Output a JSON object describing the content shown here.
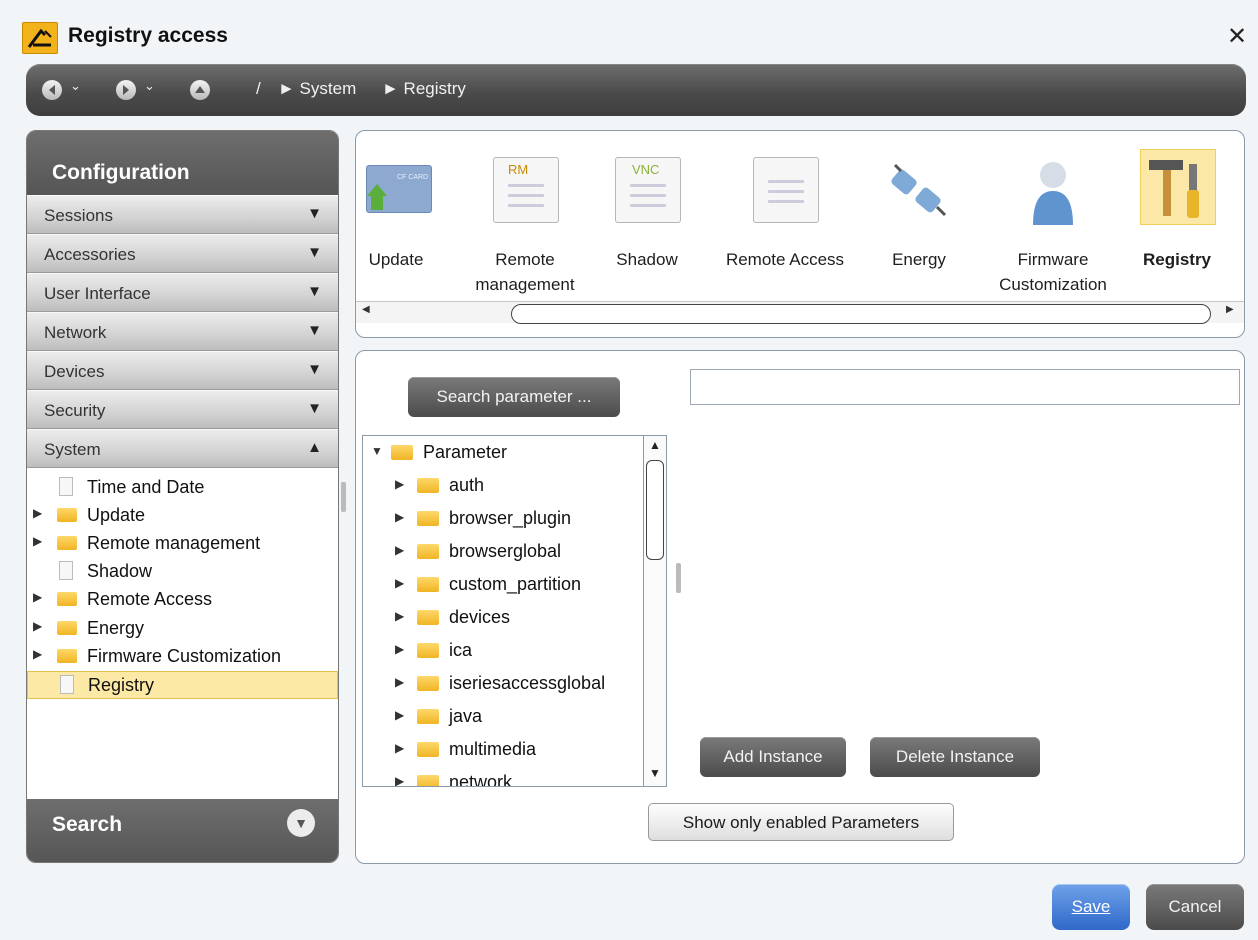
{
  "window": {
    "title": "Registry access",
    "close": "✕"
  },
  "navbar": {
    "back_caret": "⌄",
    "forward_caret": "⌄",
    "breadcrumb": [
      "/",
      "► System",
      "► Registry"
    ]
  },
  "sidebar": {
    "title": "Configuration",
    "categories": [
      {
        "label": "Sessions",
        "arrow": "▼"
      },
      {
        "label": "Accessories",
        "arrow": "▼"
      },
      {
        "label": "User Interface",
        "arrow": "▼"
      },
      {
        "label": "Network",
        "arrow": "▼"
      },
      {
        "label": "Devices",
        "arrow": "▼"
      },
      {
        "label": "Security",
        "arrow": "▼"
      },
      {
        "label": "System",
        "arrow": "▲"
      }
    ],
    "system_items": [
      {
        "label": "Time and Date",
        "icon": "document-icon",
        "expandable": false
      },
      {
        "label": "Update",
        "icon": "folder-icon",
        "expandable": true
      },
      {
        "label": "Remote management",
        "icon": "folder-icon",
        "expandable": true
      },
      {
        "label": "Shadow",
        "icon": "document-icon",
        "expandable": false
      },
      {
        "label": "Remote Access",
        "icon": "folder-icon",
        "expandable": true
      },
      {
        "label": "Energy",
        "icon": "folder-icon",
        "expandable": true
      },
      {
        "label": "Firmware Customization",
        "icon": "folder-icon",
        "expandable": true
      },
      {
        "label": "Registry",
        "icon": "document-icon",
        "expandable": false,
        "selected": true
      }
    ],
    "search_label": "Search"
  },
  "toolstrip": {
    "items": [
      {
        "label": "Update",
        "icon": "cf-card-update-icon",
        "badge": "CF CARD"
      },
      {
        "label": "Remote management",
        "icon": "remote-management-icon",
        "badge": "RM"
      },
      {
        "label": "Shadow",
        "icon": "vnc-shadow-icon",
        "badge": "VNC"
      },
      {
        "label": "Remote Access",
        "icon": "remote-access-list-icon",
        "badge": ""
      },
      {
        "label": "Energy",
        "icon": "power-plug-icon",
        "badge": ""
      },
      {
        "label": "Firmware Customization",
        "icon": "user-icon",
        "badge": ""
      },
      {
        "label": "Registry",
        "icon": "tools-icon",
        "badge": "",
        "active": true
      }
    ]
  },
  "registry": {
    "search_button": "Search parameter ...",
    "value_field": "",
    "tree": {
      "root": "Parameter",
      "children": [
        "auth",
        "browser_plugin",
        "browserglobal",
        "custom_partition",
        "devices",
        "ica",
        "iseriesaccessglobal",
        "java",
        "multimedia",
        "network"
      ]
    },
    "add_instance": "Add Instance",
    "delete_instance": "Delete Instance",
    "show_enabled": "Show only enabled Parameters"
  },
  "footer": {
    "save": "Save",
    "cancel": "Cancel"
  },
  "colors": {
    "accent": "#2f68c8",
    "selection": "#fde9a6",
    "panel_dark": "#555555"
  }
}
